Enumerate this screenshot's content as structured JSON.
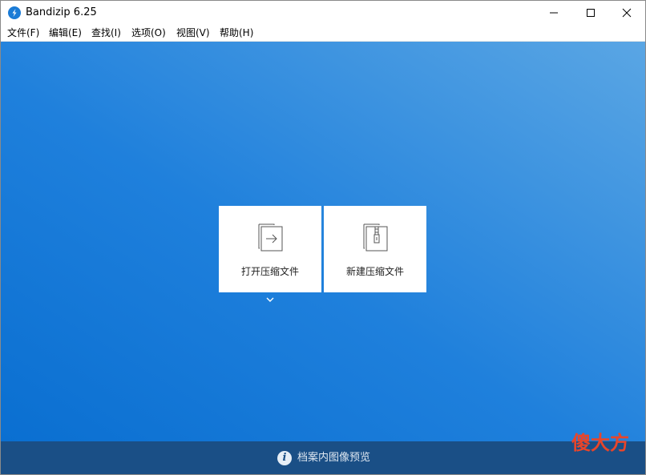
{
  "window": {
    "title": "Bandizip 6.25",
    "accent_color": "#1a7bd6"
  },
  "menu": {
    "items": [
      "文件(F)",
      "编辑(E)",
      "查找(I)",
      "选项(O)",
      "视图(V)",
      "帮助(H)"
    ]
  },
  "main": {
    "open_card_label": "打开压缩文件",
    "new_card_label": "新建压缩文件",
    "open_card_icon": "open-archive-icon",
    "new_card_icon": "new-archive-icon",
    "background_top_color": "#5aa6e4",
    "background_bottom_color": "#0a6fd1"
  },
  "status": {
    "text": "档案内图像预览",
    "icon": "info-icon"
  },
  "watermark": {
    "text": "傻大方"
  }
}
